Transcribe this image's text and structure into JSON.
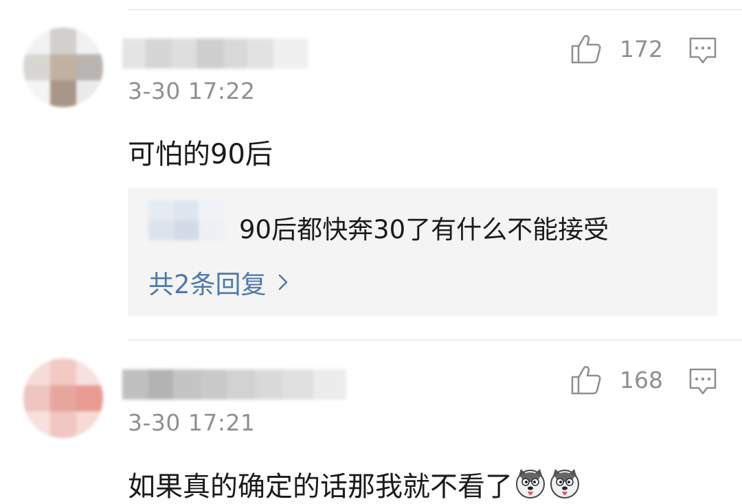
{
  "comments": [
    {
      "timestamp": "3-30 17:22",
      "text": "可怕的90后",
      "likes": "172",
      "like_icon": "thumbs-up-icon",
      "reply_icon": "comment-icon",
      "reply_preview": {
        "text": "90后都快奔30了有什么不能接受",
        "more_label": "共2条回复",
        "more_icon": "chevron-right-icon"
      }
    },
    {
      "timestamp": "3-30 17:21",
      "text": "如果真的确定的话那我就不看了",
      "likes": "168",
      "like_icon": "thumbs-up-icon",
      "reply_icon": "comment-icon",
      "emojis": [
        "husky-emoji-icon",
        "husky-emoji-icon"
      ]
    }
  ],
  "colors": {
    "link_blue": "#4f78a8",
    "meta_gray": "#8f8f8f",
    "reply_bg": "#f4f4f4"
  }
}
